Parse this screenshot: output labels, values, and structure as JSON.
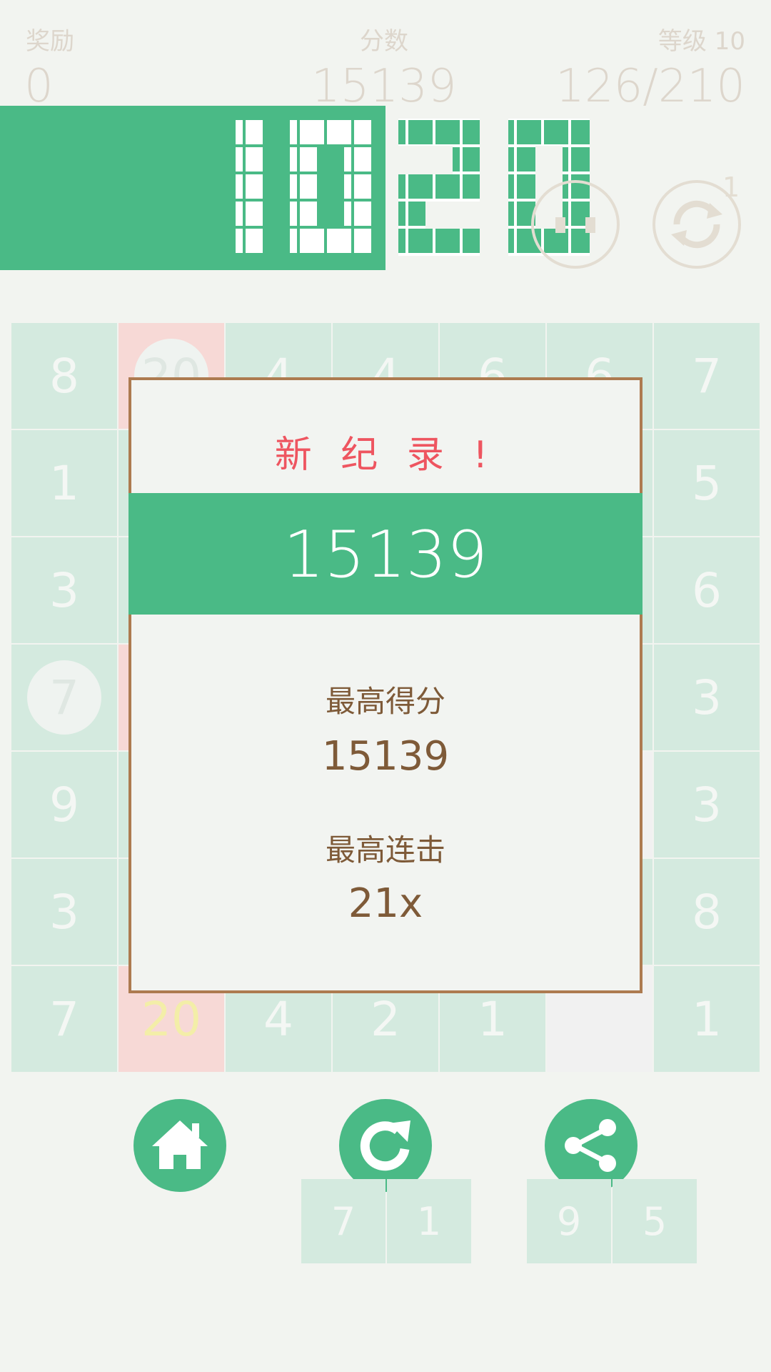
{
  "header": {
    "reward_label": "奖励",
    "reward_value": "0",
    "score_label": "分数",
    "score_value": "15139",
    "level_label": "等级 10",
    "level_progress": "126/210"
  },
  "logo": {
    "text": "1020"
  },
  "top_buttons": {
    "pause_icon": "pause-icon",
    "restart_icon": "restart-icon",
    "restart_count": "1"
  },
  "board": {
    "row1": [
      "8",
      "20",
      "4",
      "4",
      "6",
      "6",
      "7"
    ],
    "col_left": [
      "1",
      "3",
      "7",
      "9",
      "3"
    ],
    "col_right": [
      "5",
      "6",
      "3",
      "3",
      "8"
    ],
    "bottom_row": [
      "7",
      "20",
      "4",
      "2",
      "1",
      "",
      "1"
    ]
  },
  "modal": {
    "title": "新 纪 录 !",
    "score": "15139",
    "best_score_label": "最高得分",
    "best_score_value": "15139",
    "best_combo_label": "最高连击",
    "best_combo_value": "21x"
  },
  "actions": {
    "home_icon": "home-icon",
    "replay_icon": "replay-icon",
    "share_icon": "share-icon"
  },
  "tray": {
    "piece_a": [
      "7",
      "1"
    ],
    "piece_b": [
      "9",
      "5"
    ]
  },
  "colors": {
    "accent": "#4aba86",
    "modal_border": "#ad7b50",
    "record_red": "#ee5560",
    "modal_text": "#7e5a38"
  }
}
